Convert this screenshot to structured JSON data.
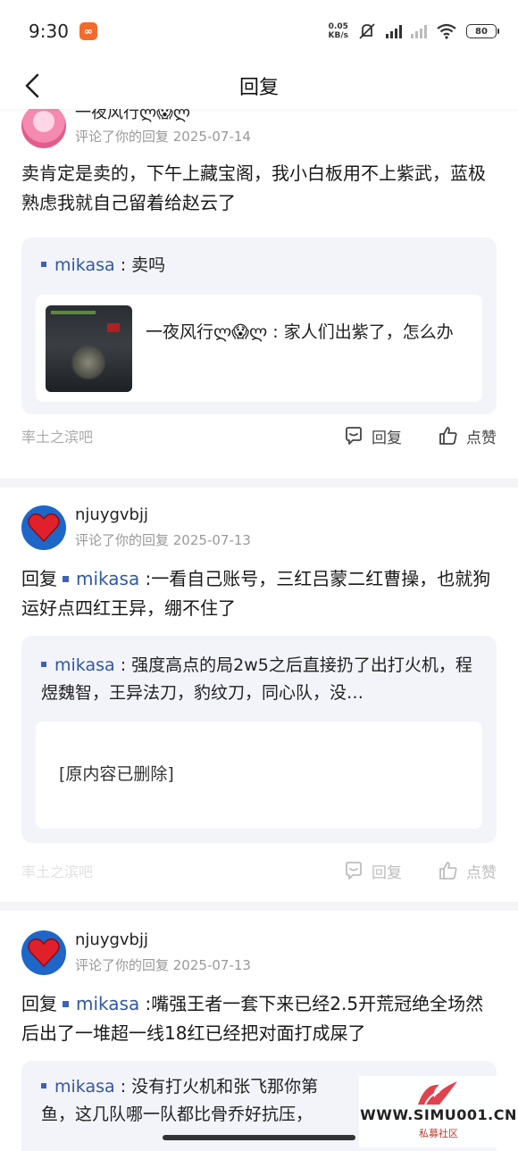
{
  "status_bar": {
    "time": "9:30",
    "app_icon": "app-icon",
    "net_speed_value": "0.05",
    "net_speed_unit": "KB/s",
    "battery": "80"
  },
  "header": {
    "title": "回复",
    "back_icon": "chevron-left-icon"
  },
  "posts": [
    {
      "username": "一夜风行ლ😱ლ",
      "meta": "评论了你的回复  2025-07-14",
      "body": "卖肯定是卖的，下午上藏宝阁，我小白板用不上紫武，蓝极熟虑我就自己留着给赵云了",
      "quote": {
        "name": "mikasa",
        "sep": " : ",
        "text": "卖吗",
        "inner_text": "一夜风行ლ😱ლ : 家人们出紫了，怎么办"
      },
      "forum": "率土之滨吧",
      "reply_label": "回复",
      "like_label": "点赞"
    },
    {
      "username": "njuygvbjj",
      "meta": "评论了你的回复  2025-07-13",
      "body_prefix": "回复",
      "body_mention": "mikasa",
      "body": " :一看自己账号，三红吕蒙二红曹操，也就狗运好点四红王异，绷不住了",
      "quote": {
        "name": "mikasa",
        "sep": " : ",
        "text": "强度高点的局2w5之后直接扔了出打火机，程煜魏智，王异法刀，豹纹刀，同心队，没…",
        "inner_text": "[原内容已删除]"
      },
      "forum": "率土之滨吧",
      "reply_label": "回复",
      "like_label": "点赞"
    },
    {
      "username": "njuygvbjj",
      "meta": "评论了你的回复  2025-07-13",
      "body_prefix": "回复",
      "body_mention": "mikasa",
      "body": " :嘴强王者一套下来已经2.5开荒冠绝全场然后出了一堆超一线18红已经把对面打成屎了",
      "quote": {
        "name": "mikasa",
        "sep": " : ",
        "text": "没有打火机和张飞那你第",
        "text2": "鱼，这几队哪一队都比骨乔好抗压，"
      }
    }
  ],
  "watermark": {
    "site": "WWW.SIMU001.CN",
    "sub": "私募社区"
  },
  "colors": {
    "mention": "#2f57a8",
    "quote_bg": "#f3f4fa",
    "meta": "#999999"
  }
}
